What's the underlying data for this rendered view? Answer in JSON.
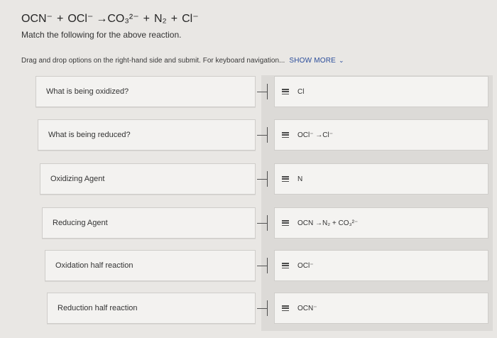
{
  "equation": {
    "parts": [
      "OCN⁻",
      "+",
      "OCl⁻",
      "→CO₃²⁻",
      "+",
      "N₂",
      "+",
      "Cl⁻"
    ]
  },
  "subtitle": "Match the following for the above reaction.",
  "instructions": {
    "text": "Drag and drop options on the right-hand side and submit. For keyboard navigation...",
    "show_more": "SHOW MORE"
  },
  "pairs": [
    {
      "prompt": "What is being oxidized?",
      "answer": "Cl"
    },
    {
      "prompt": "What is being reduced?",
      "answer": "OCl⁻ →Cl⁻"
    },
    {
      "prompt": "Oxidizing Agent",
      "answer": "N"
    },
    {
      "prompt": "Reducing Agent",
      "answer": "OCN →N₂ + CO₃²⁻"
    },
    {
      "prompt": "Oxidation half reaction",
      "answer": "OCl⁻"
    },
    {
      "prompt": "Reduction half reaction",
      "answer": "OCN⁻"
    }
  ],
  "icons": {
    "drag_handle": "drag-handle-icon",
    "chevron": "chevron-down-icon"
  }
}
